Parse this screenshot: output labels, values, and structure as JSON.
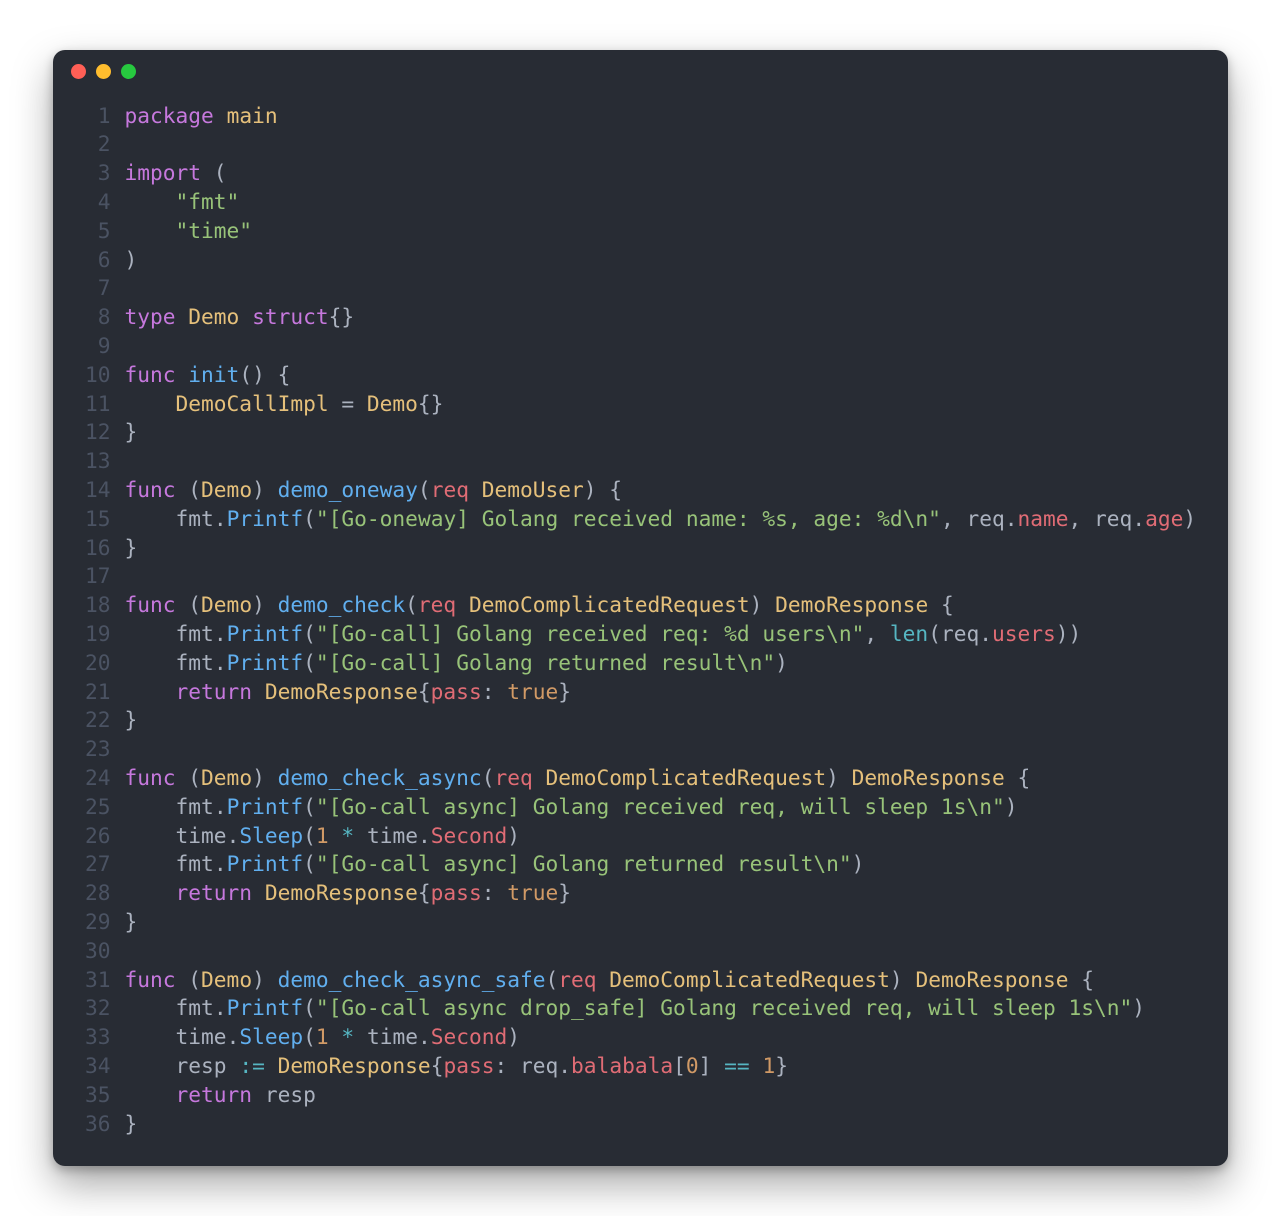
{
  "window": {
    "dots": [
      "red",
      "yellow",
      "green"
    ]
  },
  "code": {
    "lines": [
      [
        {
          "t": "package ",
          "c": "kw"
        },
        {
          "t": "main",
          "c": "pkg"
        }
      ],
      [],
      [
        {
          "t": "import ",
          "c": "kw"
        },
        {
          "t": "(",
          "c": "punc"
        }
      ],
      [
        {
          "t": "    ",
          "c": "default"
        },
        {
          "t": "\"fmt\"",
          "c": "str"
        }
      ],
      [
        {
          "t": "    ",
          "c": "default"
        },
        {
          "t": "\"time\"",
          "c": "str"
        }
      ],
      [
        {
          "t": ")",
          "c": "punc"
        }
      ],
      [],
      [
        {
          "t": "type ",
          "c": "kw"
        },
        {
          "t": "Demo ",
          "c": "type"
        },
        {
          "t": "struct",
          "c": "kw"
        },
        {
          "t": "{}",
          "c": "punc"
        }
      ],
      [],
      [
        {
          "t": "func ",
          "c": "kw"
        },
        {
          "t": "init",
          "c": "fn"
        },
        {
          "t": "() {",
          "c": "punc"
        }
      ],
      [
        {
          "t": "    ",
          "c": "default"
        },
        {
          "t": "DemoCallImpl",
          "c": "type"
        },
        {
          "t": " = ",
          "c": "default"
        },
        {
          "t": "Demo",
          "c": "type"
        },
        {
          "t": "{}",
          "c": "punc"
        }
      ],
      [
        {
          "t": "}",
          "c": "punc"
        }
      ],
      [],
      [
        {
          "t": "func ",
          "c": "kw"
        },
        {
          "t": "(",
          "c": "punc"
        },
        {
          "t": "Demo",
          "c": "type"
        },
        {
          "t": ") ",
          "c": "punc"
        },
        {
          "t": "demo_oneway",
          "c": "fn"
        },
        {
          "t": "(",
          "c": "punc"
        },
        {
          "t": "req",
          "c": "id"
        },
        {
          "t": " ",
          "c": "default"
        },
        {
          "t": "DemoUser",
          "c": "type"
        },
        {
          "t": ") {",
          "c": "punc"
        }
      ],
      [
        {
          "t": "    ",
          "c": "default"
        },
        {
          "t": "fmt",
          "c": "default"
        },
        {
          "t": ".",
          "c": "punc"
        },
        {
          "t": "Printf",
          "c": "fn"
        },
        {
          "t": "(",
          "c": "punc"
        },
        {
          "t": "\"[Go-oneway] Golang received name: %s, age: %d\\n\"",
          "c": "str"
        },
        {
          "t": ", ",
          "c": "punc"
        },
        {
          "t": "req",
          "c": "default"
        },
        {
          "t": ".",
          "c": "punc"
        },
        {
          "t": "name",
          "c": "id"
        },
        {
          "t": ", ",
          "c": "punc"
        },
        {
          "t": "req",
          "c": "default"
        },
        {
          "t": ".",
          "c": "punc"
        },
        {
          "t": "age",
          "c": "id"
        },
        {
          "t": ")",
          "c": "punc"
        }
      ],
      [
        {
          "t": "}",
          "c": "punc"
        }
      ],
      [],
      [
        {
          "t": "func ",
          "c": "kw"
        },
        {
          "t": "(",
          "c": "punc"
        },
        {
          "t": "Demo",
          "c": "type"
        },
        {
          "t": ") ",
          "c": "punc"
        },
        {
          "t": "demo_check",
          "c": "fn"
        },
        {
          "t": "(",
          "c": "punc"
        },
        {
          "t": "req",
          "c": "id"
        },
        {
          "t": " ",
          "c": "default"
        },
        {
          "t": "DemoComplicatedRequest",
          "c": "type"
        },
        {
          "t": ") ",
          "c": "punc"
        },
        {
          "t": "DemoResponse",
          "c": "type"
        },
        {
          "t": " {",
          "c": "punc"
        }
      ],
      [
        {
          "t": "    ",
          "c": "default"
        },
        {
          "t": "fmt",
          "c": "default"
        },
        {
          "t": ".",
          "c": "punc"
        },
        {
          "t": "Printf",
          "c": "fn"
        },
        {
          "t": "(",
          "c": "punc"
        },
        {
          "t": "\"[Go-call] Golang received req: %d users\\n\"",
          "c": "str"
        },
        {
          "t": ", ",
          "c": "punc"
        },
        {
          "t": "len",
          "c": "builtin"
        },
        {
          "t": "(",
          "c": "punc"
        },
        {
          "t": "req",
          "c": "default"
        },
        {
          "t": ".",
          "c": "punc"
        },
        {
          "t": "users",
          "c": "id"
        },
        {
          "t": "))",
          "c": "punc"
        }
      ],
      [
        {
          "t": "    ",
          "c": "default"
        },
        {
          "t": "fmt",
          "c": "default"
        },
        {
          "t": ".",
          "c": "punc"
        },
        {
          "t": "Printf",
          "c": "fn"
        },
        {
          "t": "(",
          "c": "punc"
        },
        {
          "t": "\"[Go-call] Golang returned result\\n\"",
          "c": "str"
        },
        {
          "t": ")",
          "c": "punc"
        }
      ],
      [
        {
          "t": "    ",
          "c": "default"
        },
        {
          "t": "return ",
          "c": "kw"
        },
        {
          "t": "DemoResponse",
          "c": "type"
        },
        {
          "t": "{",
          "c": "punc"
        },
        {
          "t": "pass",
          "c": "id"
        },
        {
          "t": ": ",
          "c": "punc"
        },
        {
          "t": "true",
          "c": "bool"
        },
        {
          "t": "}",
          "c": "punc"
        }
      ],
      [
        {
          "t": "}",
          "c": "punc"
        }
      ],
      [],
      [
        {
          "t": "func ",
          "c": "kw"
        },
        {
          "t": "(",
          "c": "punc"
        },
        {
          "t": "Demo",
          "c": "type"
        },
        {
          "t": ") ",
          "c": "punc"
        },
        {
          "t": "demo_check_async",
          "c": "fn"
        },
        {
          "t": "(",
          "c": "punc"
        },
        {
          "t": "req",
          "c": "id"
        },
        {
          "t": " ",
          "c": "default"
        },
        {
          "t": "DemoComplicatedRequest",
          "c": "type"
        },
        {
          "t": ") ",
          "c": "punc"
        },
        {
          "t": "DemoResponse",
          "c": "type"
        },
        {
          "t": " {",
          "c": "punc"
        }
      ],
      [
        {
          "t": "    ",
          "c": "default"
        },
        {
          "t": "fmt",
          "c": "default"
        },
        {
          "t": ".",
          "c": "punc"
        },
        {
          "t": "Printf",
          "c": "fn"
        },
        {
          "t": "(",
          "c": "punc"
        },
        {
          "t": "\"[Go-call async] Golang received req, will sleep 1s\\n\"",
          "c": "str"
        },
        {
          "t": ")",
          "c": "punc"
        }
      ],
      [
        {
          "t": "    ",
          "c": "default"
        },
        {
          "t": "time",
          "c": "default"
        },
        {
          "t": ".",
          "c": "punc"
        },
        {
          "t": "Sleep",
          "c": "fn"
        },
        {
          "t": "(",
          "c": "punc"
        },
        {
          "t": "1",
          "c": "num"
        },
        {
          "t": " ",
          "c": "default"
        },
        {
          "t": "*",
          "c": "op"
        },
        {
          "t": " ",
          "c": "default"
        },
        {
          "t": "time",
          "c": "default"
        },
        {
          "t": ".",
          "c": "punc"
        },
        {
          "t": "Second",
          "c": "id"
        },
        {
          "t": ")",
          "c": "punc"
        }
      ],
      [
        {
          "t": "    ",
          "c": "default"
        },
        {
          "t": "fmt",
          "c": "default"
        },
        {
          "t": ".",
          "c": "punc"
        },
        {
          "t": "Printf",
          "c": "fn"
        },
        {
          "t": "(",
          "c": "punc"
        },
        {
          "t": "\"[Go-call async] Golang returned result\\n\"",
          "c": "str"
        },
        {
          "t": ")",
          "c": "punc"
        }
      ],
      [
        {
          "t": "    ",
          "c": "default"
        },
        {
          "t": "return ",
          "c": "kw"
        },
        {
          "t": "DemoResponse",
          "c": "type"
        },
        {
          "t": "{",
          "c": "punc"
        },
        {
          "t": "pass",
          "c": "id"
        },
        {
          "t": ": ",
          "c": "punc"
        },
        {
          "t": "true",
          "c": "bool"
        },
        {
          "t": "}",
          "c": "punc"
        }
      ],
      [
        {
          "t": "}",
          "c": "punc"
        }
      ],
      [],
      [
        {
          "t": "func ",
          "c": "kw"
        },
        {
          "t": "(",
          "c": "punc"
        },
        {
          "t": "Demo",
          "c": "type"
        },
        {
          "t": ") ",
          "c": "punc"
        },
        {
          "t": "demo_check_async_safe",
          "c": "fn"
        },
        {
          "t": "(",
          "c": "punc"
        },
        {
          "t": "req",
          "c": "id"
        },
        {
          "t": " ",
          "c": "default"
        },
        {
          "t": "DemoComplicatedRequest",
          "c": "type"
        },
        {
          "t": ") ",
          "c": "punc"
        },
        {
          "t": "DemoResponse",
          "c": "type"
        },
        {
          "t": " {",
          "c": "punc"
        }
      ],
      [
        {
          "t": "    ",
          "c": "default"
        },
        {
          "t": "fmt",
          "c": "default"
        },
        {
          "t": ".",
          "c": "punc"
        },
        {
          "t": "Printf",
          "c": "fn"
        },
        {
          "t": "(",
          "c": "punc"
        },
        {
          "t": "\"[Go-call async drop_safe] Golang received req, will sleep 1s\\n\"",
          "c": "str"
        },
        {
          "t": ")",
          "c": "punc"
        }
      ],
      [
        {
          "t": "    ",
          "c": "default"
        },
        {
          "t": "time",
          "c": "default"
        },
        {
          "t": ".",
          "c": "punc"
        },
        {
          "t": "Sleep",
          "c": "fn"
        },
        {
          "t": "(",
          "c": "punc"
        },
        {
          "t": "1",
          "c": "num"
        },
        {
          "t": " ",
          "c": "default"
        },
        {
          "t": "*",
          "c": "op"
        },
        {
          "t": " ",
          "c": "default"
        },
        {
          "t": "time",
          "c": "default"
        },
        {
          "t": ".",
          "c": "punc"
        },
        {
          "t": "Second",
          "c": "id"
        },
        {
          "t": ")",
          "c": "punc"
        }
      ],
      [
        {
          "t": "    ",
          "c": "default"
        },
        {
          "t": "resp",
          "c": "default"
        },
        {
          "t": " ",
          "c": "default"
        },
        {
          "t": ":=",
          "c": "op"
        },
        {
          "t": " ",
          "c": "default"
        },
        {
          "t": "DemoResponse",
          "c": "type"
        },
        {
          "t": "{",
          "c": "punc"
        },
        {
          "t": "pass",
          "c": "id"
        },
        {
          "t": ": ",
          "c": "punc"
        },
        {
          "t": "req",
          "c": "default"
        },
        {
          "t": ".",
          "c": "punc"
        },
        {
          "t": "balabala",
          "c": "id"
        },
        {
          "t": "[",
          "c": "punc"
        },
        {
          "t": "0",
          "c": "num"
        },
        {
          "t": "] ",
          "c": "punc"
        },
        {
          "t": "==",
          "c": "op"
        },
        {
          "t": " ",
          "c": "default"
        },
        {
          "t": "1",
          "c": "num"
        },
        {
          "t": "}",
          "c": "punc"
        }
      ],
      [
        {
          "t": "    ",
          "c": "default"
        },
        {
          "t": "return ",
          "c": "kw"
        },
        {
          "t": "resp",
          "c": "default"
        }
      ],
      [
        {
          "t": "}",
          "c": "punc"
        }
      ]
    ]
  }
}
